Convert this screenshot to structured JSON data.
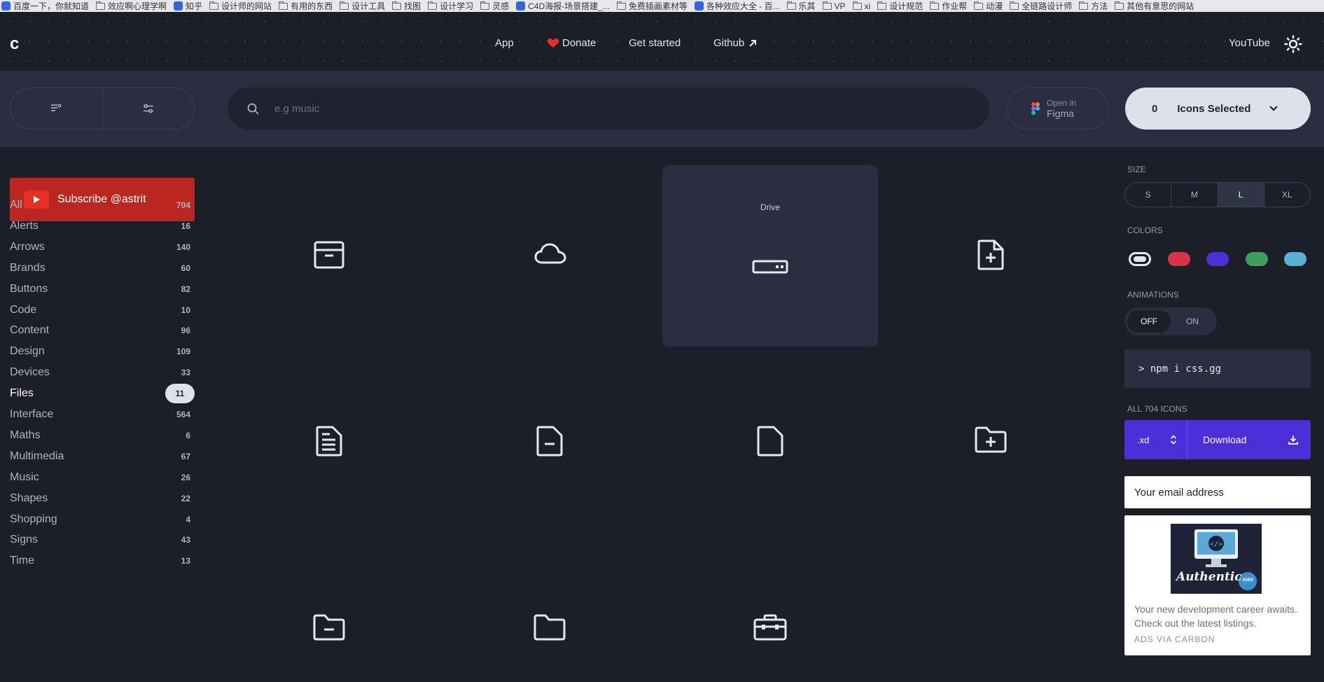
{
  "bookmarks": [
    {
      "label": "百度一下，你就知道",
      "icon": "baidu-favicon"
    },
    {
      "label": "效应啊心理学啊",
      "icon": "folder-icon"
    },
    {
      "label": "知乎",
      "icon": "zhihu-favicon"
    },
    {
      "label": "设计师的网站",
      "icon": "folder-icon"
    },
    {
      "label": "有用的东西",
      "icon": "folder-icon"
    },
    {
      "label": "设计工具",
      "icon": "folder-icon"
    },
    {
      "label": "找图",
      "icon": "folder-icon"
    },
    {
      "label": "设计学习",
      "icon": "folder-icon"
    },
    {
      "label": "灵感",
      "icon": "folder-icon"
    },
    {
      "label": "C4D海报-场景搭建_...",
      "icon": "c4d-favicon"
    },
    {
      "label": "免费插画素材等",
      "icon": "folder-icon"
    },
    {
      "label": "各种效应大全 - 百...",
      "icon": "baidu-favicon"
    },
    {
      "label": "乐其",
      "icon": "folder-icon"
    },
    {
      "label": "VP",
      "icon": "folder-icon"
    },
    {
      "label": "xi",
      "icon": "folder-icon"
    },
    {
      "label": "设计规范",
      "icon": "folder-icon"
    },
    {
      "label": "作业帮",
      "icon": "folder-icon"
    },
    {
      "label": "动漫",
      "icon": "folder-icon"
    },
    {
      "label": "全链路设计师",
      "icon": "folder-icon"
    },
    {
      "label": "方法",
      "icon": "folder-icon"
    },
    {
      "label": "其他有意思的网站",
      "icon": "folder-icon"
    }
  ],
  "nav": {
    "logo": "c",
    "app": "App",
    "donate": "Donate",
    "get_started": "Get started",
    "github": "Github",
    "youtube": "YouTube"
  },
  "toolbar": {
    "search_placeholder": "e.g music",
    "figma_line1": "Open in",
    "figma_line2": "Figma",
    "selected_count": "0",
    "selected_label": "Icons Selected"
  },
  "sidebar": {
    "subscribe": "Subscribe @astrit",
    "categories": [
      {
        "label": "All",
        "count": "704"
      },
      {
        "label": "Alerts",
        "count": "16"
      },
      {
        "label": "Arrows",
        "count": "140"
      },
      {
        "label": "Brands",
        "count": "60"
      },
      {
        "label": "Buttons",
        "count": "82"
      },
      {
        "label": "Code",
        "count": "10"
      },
      {
        "label": "Content",
        "count": "96"
      },
      {
        "label": "Design",
        "count": "109"
      },
      {
        "label": "Devices",
        "count": "33"
      },
      {
        "label": "Files",
        "count": "11",
        "active": true
      },
      {
        "label": "Interface",
        "count": "564"
      },
      {
        "label": "Maths",
        "count": "6"
      },
      {
        "label": "Multimedia",
        "count": "67"
      },
      {
        "label": "Music",
        "count": "26"
      },
      {
        "label": "Shapes",
        "count": "22"
      },
      {
        "label": "Shopping",
        "count": "4"
      },
      {
        "label": "Signs",
        "count": "43"
      },
      {
        "label": "Time",
        "count": "13"
      }
    ]
  },
  "grid": {
    "hover_label": "Drive",
    "icons": [
      "box-icon",
      "cloud-icon",
      "drive-icon",
      "file-add-icon",
      "file-document-icon",
      "file-remove-icon",
      "file-icon",
      "folder-add-icon",
      "folder-remove-icon",
      "folder-icon",
      "toolbox-icon"
    ]
  },
  "right": {
    "size_title": "SIZE",
    "sizes": [
      "S",
      "M",
      "L",
      "XL"
    ],
    "size_selected": "L",
    "colors_title": "COLORS",
    "colors": [
      "#e6e8ef",
      "#d9334a",
      "#4c2fd9",
      "#3f9e5e",
      "#5ab0d1"
    ],
    "animations_title": "ANIMATIONS",
    "anim_off": "OFF",
    "anim_on": "ON",
    "npm": "> npm i css.gg",
    "all_icons": "ALL 704 ICONS",
    "format": ".xd",
    "download": "Download",
    "email_placeholder": "Your email address",
    "ad_text": "Your new development career awaits. Check out the latest listings.",
    "ad_by": "ADS VIA CARBON",
    "ad_logo_text": "Authentic",
    "ad_badge": "JOBS"
  }
}
